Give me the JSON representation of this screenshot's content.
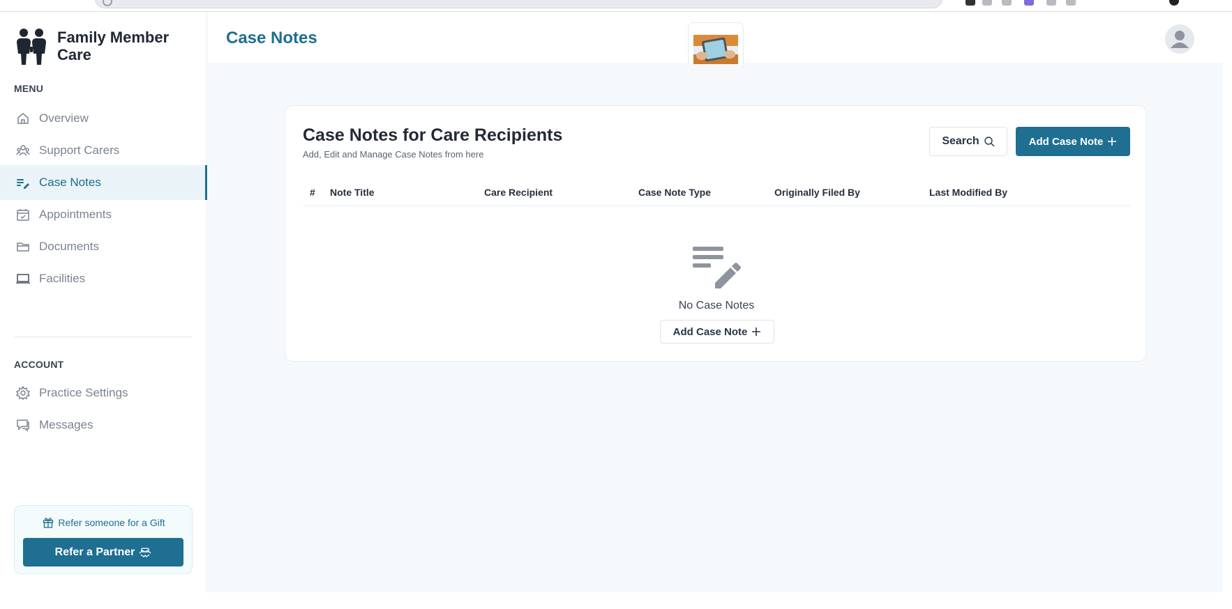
{
  "brand": {
    "name": "Family Member Care",
    "logo_icon": "family-people-icon"
  },
  "sidebar": {
    "menu_label": "MENU",
    "menu_items": [
      {
        "label": "Overview",
        "icon": "home-icon",
        "active": false
      },
      {
        "label": "Support Carers",
        "icon": "users-icon",
        "active": false
      },
      {
        "label": "Case Notes",
        "icon": "notes-edit-icon",
        "active": true
      },
      {
        "label": "Appointments",
        "icon": "calendar-check-icon",
        "active": false
      },
      {
        "label": "Documents",
        "icon": "folder-icon",
        "active": false
      },
      {
        "label": "Facilities",
        "icon": "laptop-icon",
        "active": false
      }
    ],
    "account_label": "ACCOUNT",
    "account_items": [
      {
        "label": "Practice Settings",
        "icon": "gear-icon"
      },
      {
        "label": "Messages",
        "icon": "chat-icon"
      }
    ],
    "refer": {
      "gift_text": "Refer someone for a Gift",
      "button_label": "Refer a Partner"
    }
  },
  "header": {
    "title": "Case Notes"
  },
  "card": {
    "title": "Case Notes for Care Recipients",
    "subtitle": "Add, Edit and Manage Case Notes from here",
    "search_label": "Search",
    "add_label": "Add Case Note",
    "columns": [
      "#",
      "Note Title",
      "Care Recipient",
      "Case Note Type",
      "Originally Filed By",
      "Last Modified By"
    ],
    "empty": {
      "text": "No Case Notes",
      "button_label": "Add Case Note"
    }
  },
  "colors": {
    "accent": "#1e6f91",
    "active_bg": "#eaf3f7",
    "main_bg": "#f6f9fc"
  }
}
